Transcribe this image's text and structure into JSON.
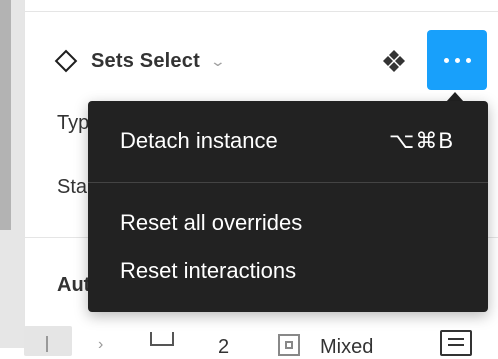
{
  "instance": {
    "name": "Sets Select",
    "icon": "component-instance-icon",
    "dropdown_icon": "chevron-down-icon"
  },
  "toolbar": {
    "goto_main_icon": "go-to-main-component-icon",
    "more_icon": "more-options-icon",
    "accent": "#18a0fb"
  },
  "properties": [
    {
      "label": "Typ"
    },
    {
      "label": "Sta"
    }
  ],
  "auto_layout": {
    "title": "Aut",
    "spacing_value": "2",
    "padding_value": "Mixed"
  },
  "context_menu": {
    "background": "#222222",
    "items": [
      {
        "label": "Detach instance",
        "shortcut": "⌥⌘B"
      },
      {
        "label": "Reset all overrides",
        "shortcut": ""
      },
      {
        "label": "Reset interactions",
        "shortcut": ""
      }
    ]
  }
}
